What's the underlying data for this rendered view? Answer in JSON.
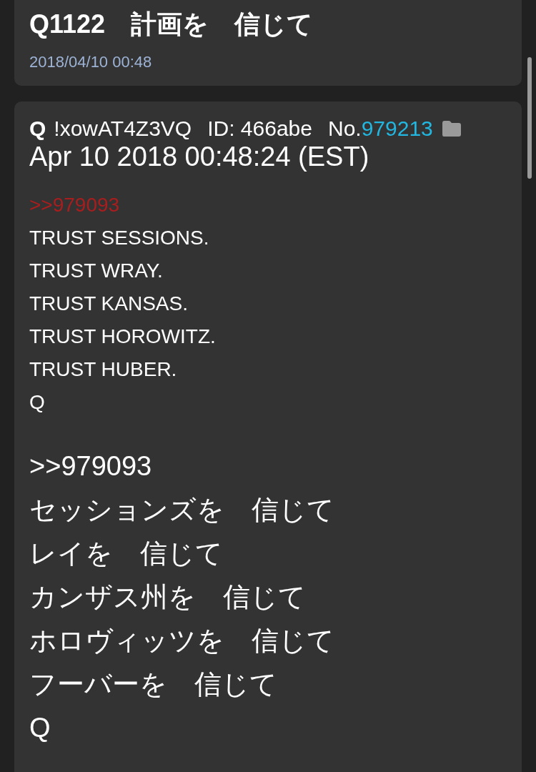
{
  "thread": {
    "title": "Q1122　計画を　信じて",
    "date": "2018/04/10 00:48"
  },
  "post": {
    "name": "Q",
    "tripcode": "!xowAT4Z3VQ",
    "id": "ID: 466abe",
    "number_label": "No.",
    "number": "979213",
    "timestamp": "Apr 10 2018 00:48:24 (EST)",
    "reply_link": ">>979093",
    "lines": [
      "TRUST SESSIONS.",
      "TRUST WRAY.",
      "TRUST KANSAS.",
      "TRUST HOROWITZ.",
      "TRUST HUBER.",
      "Q"
    ]
  },
  "translation": {
    "reply_reference": ">>979093",
    "lines": [
      "セッションズを　信じて",
      "レイを　信じて",
      "カンザス州を　信じて",
      "ホロヴィッツを　信じて",
      "フーバーを　信じて",
      "Q"
    ]
  }
}
